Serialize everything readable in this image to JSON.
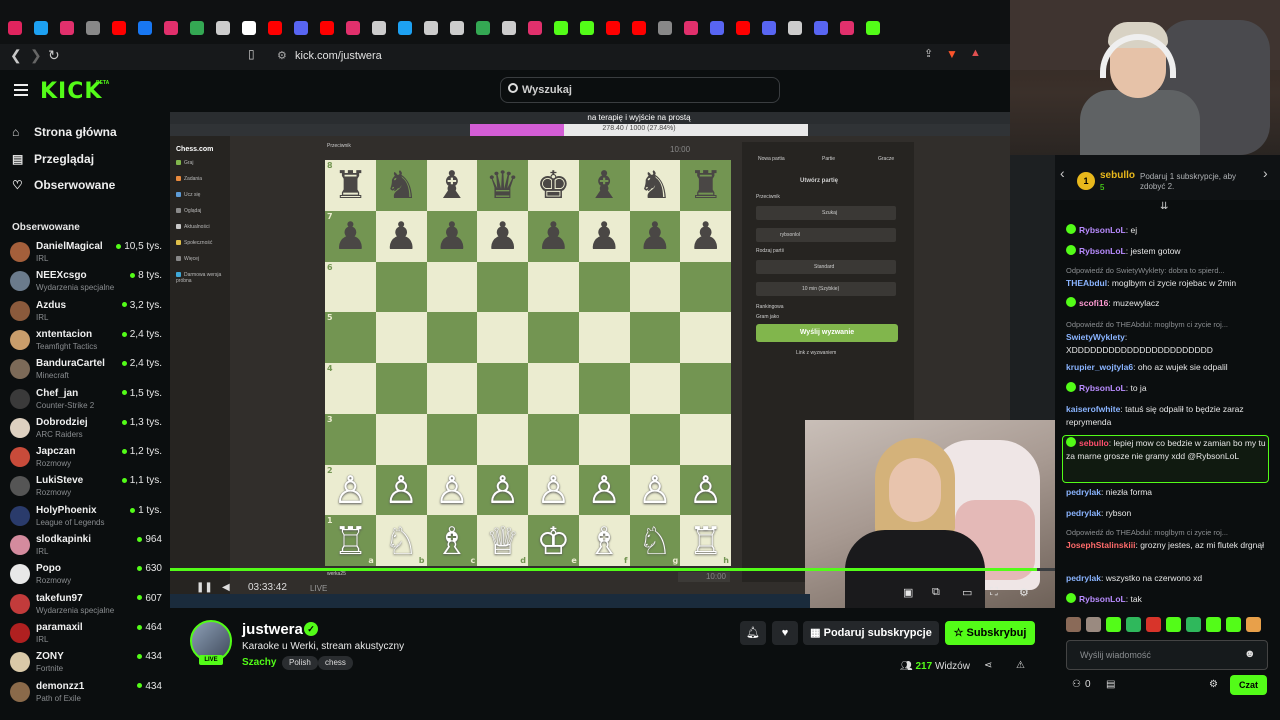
{
  "browser": {
    "url": "kick.com/justwera",
    "tab_icons": [
      "#e0245e",
      "#1da1f2",
      "#e1306c",
      "#888888",
      "#ff0000",
      "#1877f2",
      "#e1306c",
      "#34a853",
      "#cccccc",
      "#ffffff",
      "#ff0000",
      "#5865f2",
      "#ff0000",
      "#e1306c",
      "#cccccc",
      "#1da1f2",
      "#cccccc",
      "#cccccc",
      "#34a853",
      "#cccccc",
      "#e1306c",
      "#53fc18",
      "#53fc18",
      "#ff0000",
      "#ff0000",
      "#888888",
      "#e1306c",
      "#5865f2",
      "#ff0000",
      "#5865f2",
      "#cccccc",
      "#5865f2",
      "#e1306c",
      "#53fc18"
    ]
  },
  "header": {
    "logo": "KICK",
    "beta": "BETA",
    "search_placeholder": "Wyszukaj"
  },
  "sidebar": {
    "nav": [
      {
        "label": "Strona główna",
        "icon": "home-icon"
      },
      {
        "label": "Przeglądaj",
        "icon": "browse-icon"
      },
      {
        "label": "Obserwowane",
        "icon": "heart-icon"
      }
    ],
    "following_heading": "Obserwowane",
    "following": [
      {
        "name": "DanielMagical",
        "category": "IRL",
        "viewers": "10,5 tys.",
        "color": "#a45f3b"
      },
      {
        "name": "NEEXcsgo",
        "category": "Wydarzenia specjalne",
        "viewers": "8 tys.",
        "color": "#6b7b8c"
      },
      {
        "name": "Azdus",
        "category": "IRL",
        "viewers": "3,2 tys.",
        "color": "#8b5a3c"
      },
      {
        "name": "xntentacion",
        "category": "Teamfight Tactics",
        "viewers": "2,4 tys.",
        "color": "#c99d6b"
      },
      {
        "name": "BanduraCartel",
        "category": "Minecraft",
        "viewers": "2,4 tys.",
        "color": "#7c6a58"
      },
      {
        "name": "Chef_jan",
        "category": "Counter-Strike 2",
        "viewers": "1,5 tys.",
        "color": "#3a3a3a"
      },
      {
        "name": "Dobrodziej",
        "category": "ARC Raiders",
        "viewers": "1,3 tys.",
        "color": "#ddd0c0"
      },
      {
        "name": "Japczan",
        "category": "Rozmowy",
        "viewers": "1,2 tys.",
        "color": "#c84b3a"
      },
      {
        "name": "LukiSteve",
        "category": "Rozmowy",
        "viewers": "1,1 tys.",
        "color": "#555555"
      },
      {
        "name": "HolyPhoenix",
        "category": "League of Legends",
        "viewers": "1 tys.",
        "color": "#2a3b6b"
      },
      {
        "name": "slodkapinki",
        "category": "IRL",
        "viewers": "964",
        "color": "#d48b9e"
      },
      {
        "name": "Popo",
        "category": "Rozmowy",
        "viewers": "630",
        "color": "#e8e8e8"
      },
      {
        "name": "takefun97",
        "category": "Wydarzenia specjalne",
        "viewers": "607",
        "color": "#c23b3b"
      },
      {
        "name": "paramaxil",
        "category": "IRL",
        "viewers": "464",
        "color": "#b02020"
      },
      {
        "name": "ZONY",
        "category": "Fortnite",
        "viewers": "434",
        "color": "#d9c9a8"
      },
      {
        "name": "demonzz1",
        "category": "Path of Exile",
        "viewers": "434",
        "color": "#8a6a4a"
      }
    ]
  },
  "video": {
    "overlay_title": "na terapię i wyjście na prostą",
    "banner_progress": "278.40 / 1000 (27.84%)",
    "banner_fraction": 0.2784,
    "chess_logo": "Chess.com",
    "chess_nav": [
      "Graj",
      "Zadania",
      "Ucz się",
      "Oglądaj",
      "Aktualności",
      "Społeczność",
      "Więcej",
      "Darmowa wersja próbna"
    ],
    "player_top": "Przeciwnik",
    "player_bottom": "werka25",
    "clock_top": "10:00",
    "clock_bottom": "10:00",
    "panel": {
      "tabs": [
        "Nowa partia",
        "Partie",
        "Gracze"
      ],
      "title": "Utwórz partię",
      "opponent_label": "Przeciwnik",
      "search_label": "Szukaj",
      "friend": "rybsonlol",
      "type_label": "Rodzaj partii",
      "type_value": "Standard",
      "time_value": "10 min (Szybkie)",
      "rated_label": "Rankingowa",
      "play_as_label": "Gram jako",
      "cta": "Wyślij wyzwanie",
      "link": "Link z wyzwaniem"
    },
    "elapsed": "03:33:42",
    "live_label": "LIVE",
    "progress_fraction": 0.98,
    "board": [
      [
        "♜",
        "♞",
        "♝",
        "♛",
        "♚",
        "♝",
        "♞",
        "♜"
      ],
      [
        "♟",
        "♟",
        "♟",
        "♟",
        "♟",
        "♟",
        "♟",
        "♟"
      ],
      [
        "",
        "",
        "",
        "",
        "",
        "",
        "",
        ""
      ],
      [
        "",
        "",
        "",
        "",
        "",
        "",
        "",
        ""
      ],
      [
        "",
        "",
        "",
        "",
        "",
        "",
        "",
        ""
      ],
      [
        "",
        "",
        "",
        "",
        "",
        "",
        "",
        ""
      ],
      [
        "♙",
        "♙",
        "♙",
        "♙",
        "♙",
        "♙",
        "♙",
        "♙"
      ],
      [
        "♖",
        "♘",
        "♗",
        "♕",
        "♔",
        "♗",
        "♘",
        "♖"
      ]
    ],
    "ranks": [
      "8",
      "7",
      "6",
      "5",
      "4",
      "3",
      "2",
      "1"
    ],
    "files": [
      "a",
      "b",
      "c",
      "d",
      "e",
      "f",
      "g",
      "h"
    ]
  },
  "channel": {
    "name": "justwera",
    "live_badge": "LIVE",
    "title": "Karaoke u Werki, stream akustyczny",
    "category": "Szachy",
    "tags": [
      "Polish",
      "chess"
    ],
    "gift_sub_label": "Podaruj subskrypcje",
    "subscribe_label": "Subskrybuj",
    "viewers_count": "217",
    "viewers_label": "Widzów"
  },
  "chat": {
    "gift": {
      "rank": "1",
      "user": "sebullo",
      "count": "5",
      "message": "Podaruj 1 subskrypcje, aby zdobyć 2."
    },
    "messages": [
      {
        "user": "RybsonLoL",
        "color": "#b98cff",
        "text": "ej",
        "badge": true
      },
      {
        "user": "RybsonLoL",
        "color": "#b98cff",
        "text": "jestem gotow",
        "badge": true
      },
      {
        "reply": "Odpowiedź do SwietyWyklety: dobra to spierd...",
        "user": "THEAbdul",
        "color": "#8ab4ff",
        "text": "moglbym ci zycie rojebac w 2min"
      },
      {
        "user": "scofi16",
        "color": "#ff9bd2",
        "text": "muzewylacz",
        "badge": true
      },
      {
        "reply": "Odpowiedź do THEAbdul: moglbym ci zycie roj...",
        "user": "SwietyWyklety",
        "color": "#8ab4ff",
        "text": "XDDDDDDDDDDDDDDDDDDDDDDD"
      },
      {
        "user": "krupier_wojtyla6",
        "color": "#8ab4ff",
        "text": "oho az wujek sie odpalil"
      },
      {
        "user": "RybsonLoL",
        "color": "#b98cff",
        "text": "to ja",
        "badge": true
      },
      {
        "user": "kaiserofwhite",
        "color": "#8ab4ff",
        "text": "tatuś się odpalił to będzie zaraz reprymenda"
      },
      {
        "user": "sebullo",
        "color": "#ff4f6d",
        "text": "lepiej mow co bedzie w zamian bo my tu za marne grosze nie gramy xdd @RybsonLoL",
        "highlight": true
      },
      {
        "user": "pedrylak",
        "color": "#8ab4ff",
        "text": "niezła forma"
      },
      {
        "user": "pedrylak",
        "color": "#8ab4ff",
        "text": "rybson"
      },
      {
        "reply": "Odpowiedź do THEAbdul: moglbym ci zycie roj...",
        "user": "JosephStalinskiii",
        "color": "#ff6b6b",
        "text": "grozny jestes, az mi flutek drgnął"
      },
      {
        "user": "pedrylak",
        "color": "#8ab4ff",
        "text": "wszystko na czerwono xd"
      },
      {
        "user": "RybsonLoL",
        "color": "#b98cff",
        "text": "tak",
        "badge": true
      }
    ],
    "emote_colors": [
      "#8a6a58",
      "#9a8a80",
      "#53fc18",
      "#2fb85c",
      "#d8342a",
      "#53fc18",
      "#2fb85c",
      "#53fc18",
      "#53fc18",
      "#e8a04a"
    ],
    "input_placeholder": "Wyślij wiadomość",
    "points": "0",
    "send_label": "Czat"
  }
}
